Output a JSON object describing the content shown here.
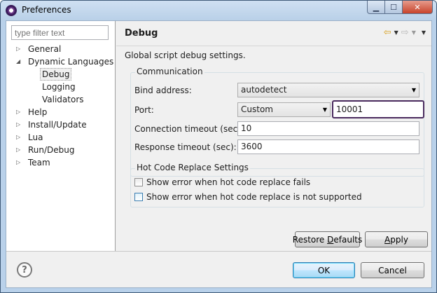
{
  "window": {
    "title": "Preferences",
    "app_icon": "eclipse-icon"
  },
  "filter": {
    "placeholder": "type filter text"
  },
  "tree": [
    {
      "label": "General",
      "toggle": "▷"
    },
    {
      "label": "Dynamic Languages",
      "toggle": "◢"
    },
    {
      "label": "Debug",
      "toggle": ""
    },
    {
      "label": "Logging",
      "toggle": ""
    },
    {
      "label": "Validators",
      "toggle": ""
    },
    {
      "label": "Help",
      "toggle": "▷"
    },
    {
      "label": "Install/Update",
      "toggle": "▷"
    },
    {
      "label": "Lua",
      "toggle": "▷"
    },
    {
      "label": "Run/Debug",
      "toggle": "▷"
    },
    {
      "label": "Team",
      "toggle": "▷"
    }
  ],
  "page": {
    "title": "Debug",
    "description": "Global script debug settings.",
    "nav": {
      "back": "⇦",
      "forward": "⇨",
      "menu": "▼"
    }
  },
  "communication": {
    "legend": "Communication",
    "bind_address_label": "Bind address:",
    "bind_address_value": "autodetect",
    "port_label": "Port:",
    "port_mode": "Custom",
    "port_value": "10001",
    "connection_timeout_label": "Connection timeout (sec):",
    "connection_timeout_value": "10",
    "response_timeout_label": "Response timeout (sec):",
    "response_timeout_value": "3600"
  },
  "hot_code": {
    "legend": "Hot Code Replace Settings",
    "opt_fails": "Show error when hot code replace fails",
    "opt_not_supported": "Show error when hot code replace is not supported"
  },
  "buttons": {
    "restore_pre": "Restore ",
    "restore_mn": "D",
    "restore_post": "efaults",
    "apply_mn": "A",
    "apply_post": "pply",
    "ok": "OK",
    "cancel": "Cancel",
    "help": "?"
  },
  "colors": {
    "focus_border": "#4a2b5e",
    "default_button": "#a7d9f5"
  }
}
